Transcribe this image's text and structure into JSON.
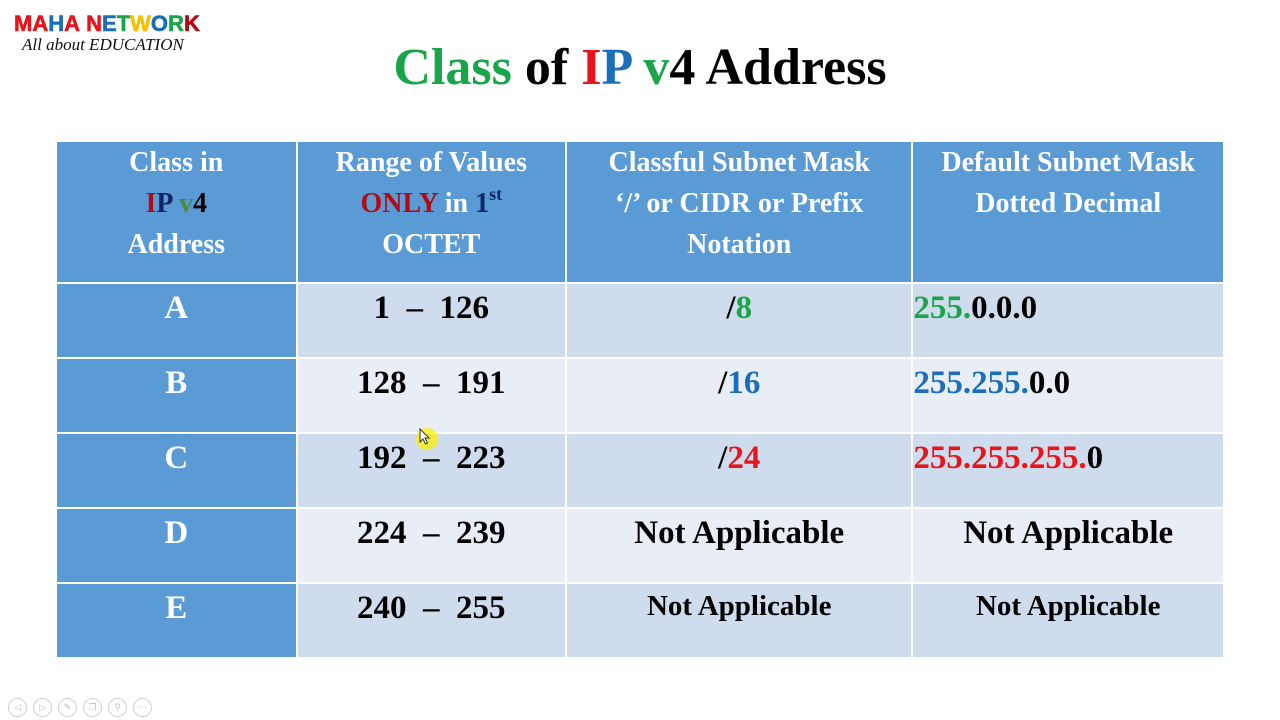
{
  "logo": {
    "brand_letters": [
      {
        "ch": "M",
        "color": "#e8141c"
      },
      {
        "ch": "A",
        "color": "#e8141c"
      },
      {
        "ch": "H",
        "color": "#1a6fb8"
      },
      {
        "ch": "A",
        "color": "#e8141c"
      },
      {
        "ch": " ",
        "color": "#000000"
      },
      {
        "ch": "N",
        "color": "#e8141c"
      },
      {
        "ch": "E",
        "color": "#1a6fb8"
      },
      {
        "ch": "T",
        "color": "#1aa54a"
      },
      {
        "ch": "W",
        "color": "#f2c200"
      },
      {
        "ch": "O",
        "color": "#1a6fb8"
      },
      {
        "ch": "R",
        "color": "#1aa54a"
      },
      {
        "ch": "K",
        "color": "#b30a14"
      }
    ],
    "tagline": "All about EDUCATION"
  },
  "title": {
    "parts": [
      {
        "text": "Class",
        "color": "#1aa54a"
      },
      {
        "text": " of ",
        "color": "#000000"
      },
      {
        "text": "I",
        "color": "#e8141c"
      },
      {
        "text": "P",
        "color": "#1a6fb8"
      },
      {
        "text": " v",
        "color": "#1aa54a"
      },
      {
        "text": "4 Address",
        "color": "#000000"
      }
    ]
  },
  "table": {
    "headers": {
      "class": {
        "line1": "Class in",
        "ip_i": "I",
        "ip_p": "P",
        "ip_v": " v",
        "ip_4": "4",
        "line3": "Address"
      },
      "range": {
        "line1": "Range of Values",
        "only": "ONLY",
        "in": " in ",
        "one": "1",
        "sup": "st",
        "line3": "OCTET"
      },
      "cidr": {
        "line1": "Classful Subnet Mask",
        "line2": "‘/’ or CIDR or Prefix",
        "line3": "Notation"
      },
      "dotted": {
        "line1": "Default Subnet Mask",
        "line2": "Dotted Decimal"
      }
    },
    "rows": [
      {
        "class": "A",
        "range": "1  –  126",
        "cidr_slash": "/",
        "cidr_bits": "8",
        "cidr_color": "#1aa54a",
        "mask_colored": "255.",
        "mask_rest": "0.0.0",
        "mask_color": "#1aa54a"
      },
      {
        "class": "B",
        "range": "128  –  191",
        "cidr_slash": "/",
        "cidr_bits": "16",
        "cidr_color": "#1a6fb8",
        "mask_colored": "255.255.",
        "mask_rest": "0.0",
        "mask_color": "#1a6fb8"
      },
      {
        "class": "C",
        "range": "192  –  223",
        "cidr_slash": "/",
        "cidr_bits": "24",
        "cidr_color": "#e8141c",
        "mask_colored": "255.255.255.",
        "mask_rest": "0",
        "mask_color": "#e8141c"
      },
      {
        "class": "D",
        "range": "224  –  239",
        "cidr_text": "Not Applicable",
        "mask_text": "Not Applicable"
      },
      {
        "class": "E",
        "range": "240  –  255",
        "cidr_text": "Not Applicable",
        "mask_text": "Not Applicable"
      }
    ]
  },
  "slide_controls": [
    {
      "name": "previous-slide",
      "glyph": "◁"
    },
    {
      "name": "next-slide",
      "glyph": "▷"
    },
    {
      "name": "pen-tool",
      "glyph": "✎"
    },
    {
      "name": "slide-sorter",
      "glyph": "❐"
    },
    {
      "name": "zoom",
      "glyph": "⚲"
    },
    {
      "name": "more-options",
      "glyph": "⋯"
    }
  ]
}
